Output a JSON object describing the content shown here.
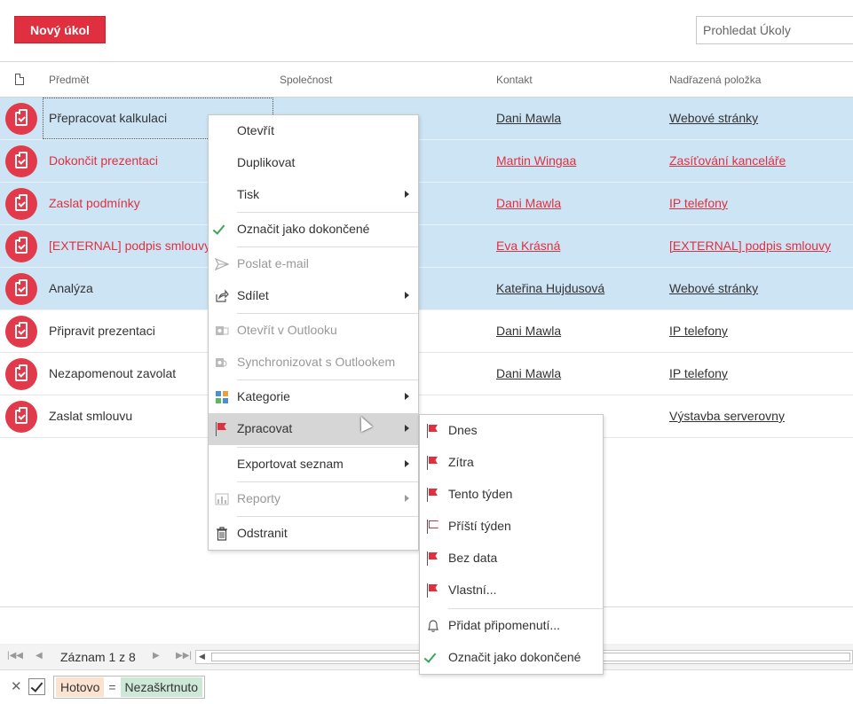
{
  "toolbar": {
    "new_task_label": "Nový úkol"
  },
  "search": {
    "placeholder": "Prohledat Úkoly"
  },
  "columns": {
    "subject": "Předmět",
    "company": "Společnost",
    "contact": "Kontakt",
    "parent": "Nadřazená položka"
  },
  "rows": [
    {
      "subject": "Přepracovat kalkulaci",
      "company": "",
      "contact": "Dani Mawla",
      "parent": "Webové stránky",
      "overdue": false,
      "selected": true
    },
    {
      "subject": "Dokončit prezentaci",
      "company": "",
      "contact": "Martin Wingaa",
      "parent": "Zasíťování kanceláře",
      "overdue": true,
      "selected": true
    },
    {
      "subject": "Zaslat podmínky",
      "company": "",
      "contact": "Dani Mawla",
      "parent": "IP telefony",
      "overdue": true,
      "selected": true
    },
    {
      "subject": "[EXTERNAL] podpis smlouvy",
      "company": "",
      "contact": "Eva Krásná",
      "parent": "[EXTERNAL] podpis smlouvy",
      "overdue": true,
      "selected": true
    },
    {
      "subject": "Analýza",
      "company": "",
      "contact": "Kateřina Hujdusová",
      "parent": "Webové stránky",
      "overdue": false,
      "selected": true
    },
    {
      "subject": "Připravit prezentaci",
      "company": "",
      "contact": "Dani Mawla",
      "parent": "IP telefony",
      "overdue": false,
      "selected": false
    },
    {
      "subject": "Nezapomenout zavolat",
      "company": "",
      "contact": "Dani Mawla",
      "parent": "IP telefony",
      "overdue": false,
      "selected": false
    },
    {
      "subject": "Zaslat smlouvu",
      "company": "",
      "contact": "",
      "parent": "Výstavba serverovny",
      "overdue": false,
      "selected": false
    }
  ],
  "context_menu": {
    "open": "Otevřít",
    "duplicate": "Duplikovat",
    "print": "Tisk",
    "mark_done": "Označit jako dokončené",
    "send_email": "Poslat e-mail",
    "share": "Sdílet",
    "open_outlook": "Otevřít v Outlooku",
    "sync_outlook": "Synchronizovat s Outlookem",
    "category": "Kategorie",
    "process": "Zpracovat",
    "export": "Exportovat seznam",
    "reports": "Reporty",
    "delete": "Odstranit"
  },
  "submenu": {
    "today": "Dnes",
    "tomorrow": "Zítra",
    "this_week": "Tento týden",
    "next_week": "Příští týden",
    "no_date": "Bez data",
    "custom": "Vlastní...",
    "add_reminder": "Přidat připomenutí...",
    "mark_done": "Označit jako dokončené"
  },
  "pager": {
    "record_text": "Záznam 1 z 8"
  },
  "filter": {
    "field": "Hotovo",
    "operator": "=",
    "value": "Nezaškrtnuto"
  },
  "colors": {
    "accent": "#e0303f",
    "selection": "#cde4f5"
  }
}
